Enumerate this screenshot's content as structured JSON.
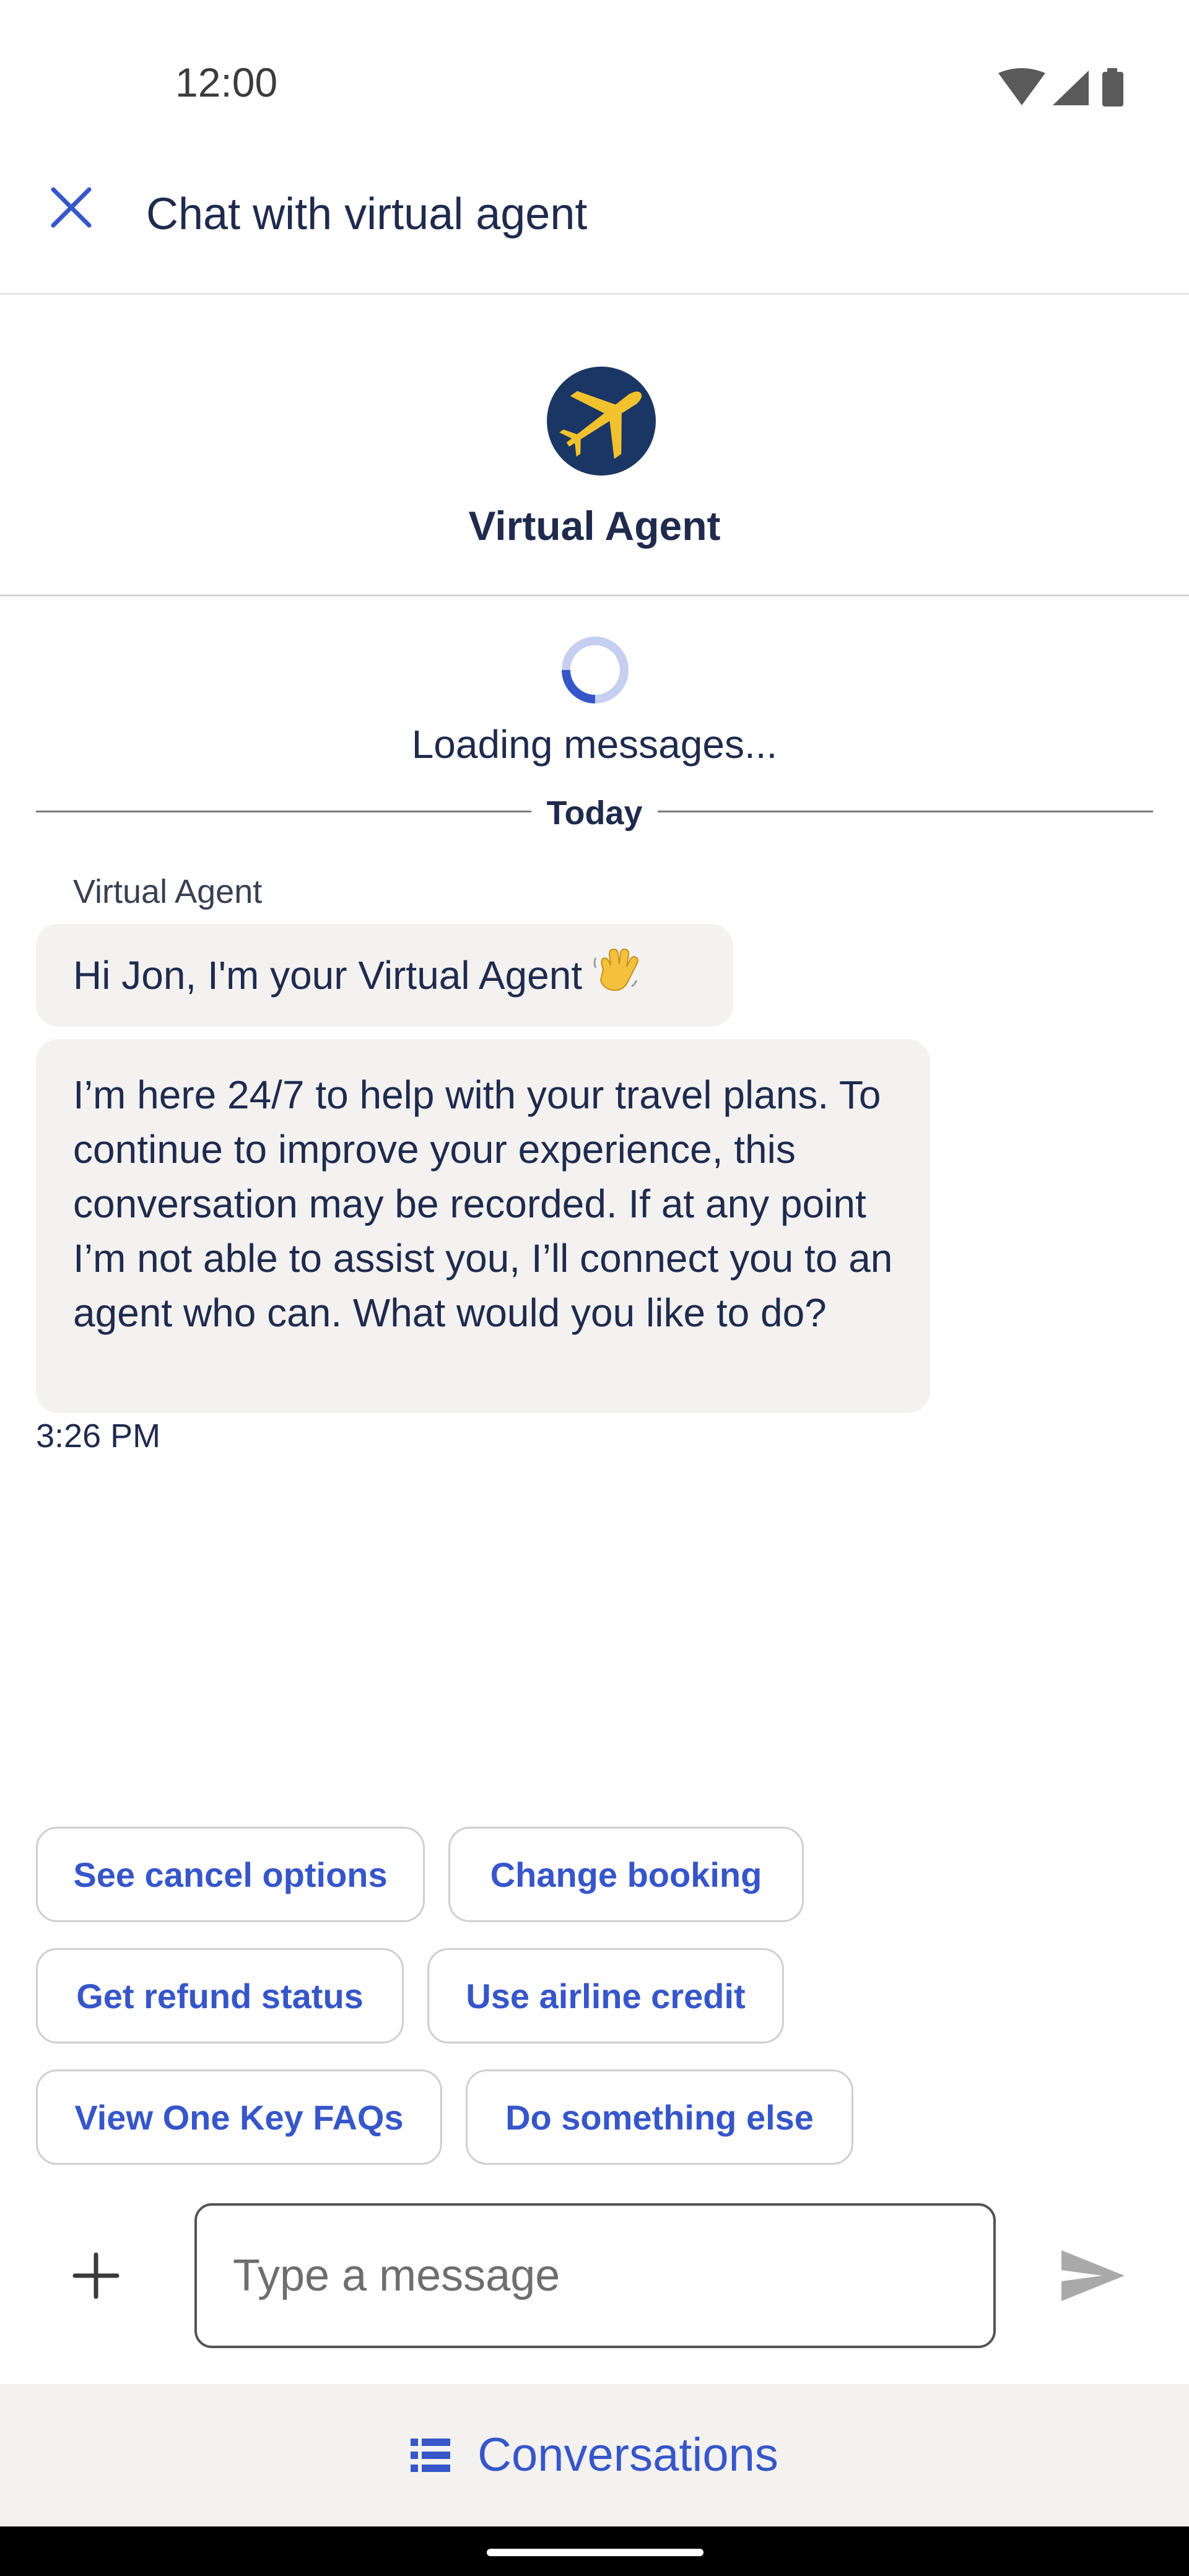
{
  "status_bar": {
    "time": "12:00"
  },
  "header": {
    "title": "Chat with virtual agent",
    "close_icon": "close-icon"
  },
  "agent": {
    "name": "Virtual Agent",
    "avatar_colors": {
      "background": "#1a3664",
      "plane": "#f2c12e"
    }
  },
  "loading": {
    "text": "Loading messages..."
  },
  "divider": {
    "label": "Today"
  },
  "messages": {
    "sender": "Virtual Agent",
    "bubble_1": "Hi Jon, I'm your Virtual Agent",
    "bubble_2": "I’m here 24/7 to help with your travel plans. To continue to improve your experience, this conversation may be recorded. If at any point I’m not able to assist you, I’ll connect you to an agent who can. What would you like to do?",
    "time": "3:26 PM"
  },
  "quick_replies": [
    "See cancel options",
    "Change booking",
    "Get refund status",
    "Use airline credit",
    "View One Key FAQs",
    "Do something else"
  ],
  "composer": {
    "placeholder": "Type a message",
    "value": ""
  },
  "footer": {
    "conversations_label": "Conversations"
  },
  "colors": {
    "accent": "#3656c9",
    "bubble": "#f3f2f1",
    "text": "#1f2b4d"
  }
}
